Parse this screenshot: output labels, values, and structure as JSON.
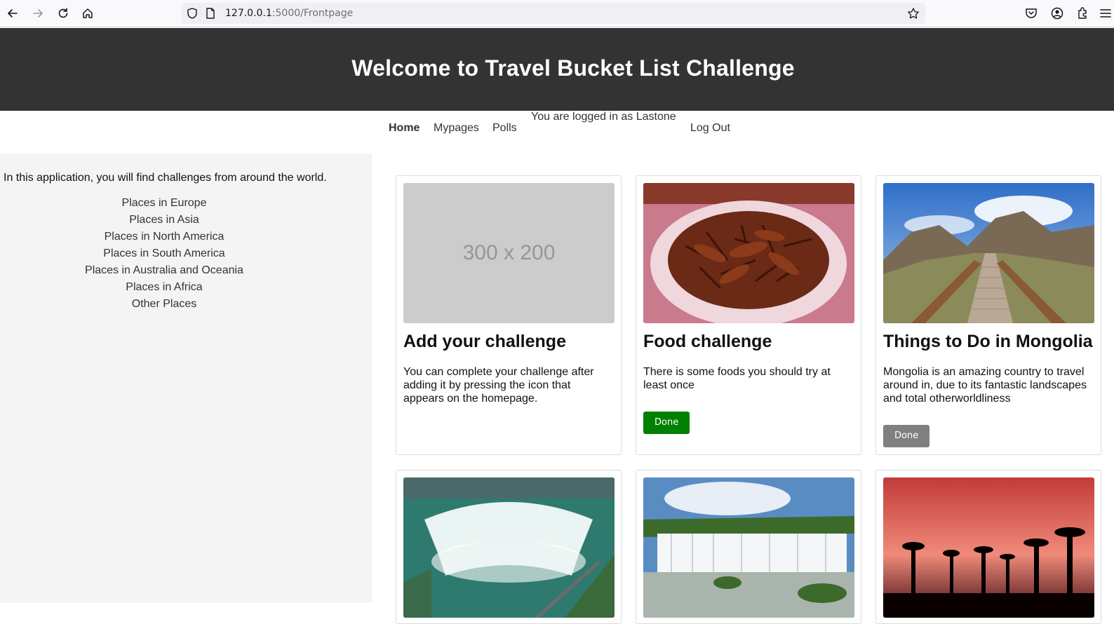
{
  "browser": {
    "url_host": "127.0.0.1",
    "url_path": ":5000/Frontpage"
  },
  "header": {
    "title": "Welcome to Travel Bucket List Challenge"
  },
  "nav": {
    "home": "Home",
    "mypages": "Mypages",
    "polls": "Polls",
    "login_status": "You are logged in as Lastone",
    "logout": "Log Out"
  },
  "sidebar": {
    "intro": "In this application, you will find challenges from around the world.",
    "links": [
      "Places in Europe",
      "Places in Asia",
      "Places in North America",
      "Places in South America",
      "Places in Australia and Oceania",
      "Places in Africa",
      "Other Places"
    ]
  },
  "cards": [
    {
      "title": "Add your challenge",
      "text": "You can complete your challenge after adding it by pressing the icon that appears on the homepage.",
      "image_placeholder": "300 x 200"
    },
    {
      "title": "Food challenge",
      "text": "There is some foods you should try at least once",
      "button": "Done",
      "button_color": "#008000"
    },
    {
      "title": "Things to Do in Mongolia",
      "text": "Mongolia is an amazing country to travel around in, due to its fantastic landscapes and total otherworldliness",
      "button": "Done",
      "button_color": "#808080"
    }
  ],
  "colors": {
    "header_bg": "#333333",
    "sidebar_bg": "#f4f4f4"
  }
}
